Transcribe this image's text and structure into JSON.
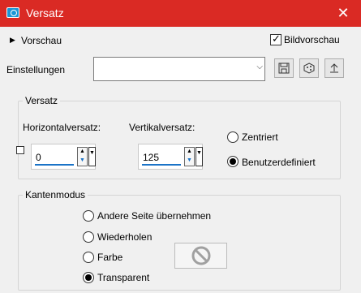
{
  "window": {
    "title": "Versatz",
    "close_glyph": "✕"
  },
  "preview": {
    "toggle_label": "Vorschau",
    "checkbox_label": "Bildvorschau",
    "checked": true
  },
  "settings": {
    "label": "Einstellungen",
    "value": ""
  },
  "offset_group": {
    "label": "Versatz",
    "horizontal_label": "Horizontalversatz:",
    "horizontal_value": "0",
    "vertical_label": "Vertikalversatz:",
    "vertical_value": "125",
    "centered_label": "Zentriert",
    "custom_label": "Benutzerdefiniert",
    "selected": "custom"
  },
  "edge_group": {
    "label": "Kantenmodus",
    "options": [
      "Andere Seite übernehmen",
      "Wiederholen",
      "Farbe",
      "Transparent"
    ],
    "selected": "Transparent"
  },
  "colors": {
    "titlebar": "#da2a24",
    "accent": "#1a73c7"
  }
}
